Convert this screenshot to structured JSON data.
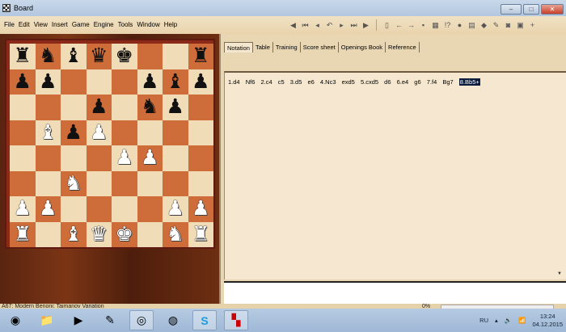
{
  "window": {
    "title": "Board",
    "minimize": "–",
    "maximize": "□",
    "close": "✕"
  },
  "menu": [
    "File",
    "Edit",
    "View",
    "Insert",
    "Game",
    "Engine",
    "Tools",
    "Window",
    "Help"
  ],
  "toolbar_icons": [
    "back-circle-icon",
    "first-move-icon",
    "prev-move-icon",
    "takeback-icon",
    "next-move-icon",
    "last-move-icon",
    "forward-circle-icon",
    "new-document-icon",
    "arrow-left-icon",
    "arrow-right-icon",
    "save-icon",
    "database-icon",
    "analysis-icon",
    "engine-icon",
    "clipboard-icon",
    "eraser-icon",
    "pen-icon",
    "camera-icon",
    "report-icon",
    "crosshair-icon"
  ],
  "tabs": [
    {
      "label": "Notation",
      "active": true
    },
    {
      "label": "Table"
    },
    {
      "label": "Training"
    },
    {
      "label": "Score sheet"
    },
    {
      "label": "Openings Book"
    },
    {
      "label": "Reference"
    }
  ],
  "board": {
    "ranks": [
      [
        "r",
        "n",
        "b",
        "q",
        "k",
        "",
        "",
        "r"
      ],
      [
        "p",
        "p",
        "",
        "",
        "",
        "p",
        "b",
        "p"
      ],
      [
        "",
        "",
        "",
        "p",
        "",
        "n",
        "p",
        ""
      ],
      [
        "",
        "B",
        "p",
        "P",
        "",
        "",
        "",
        ""
      ],
      [
        "",
        "",
        "",
        "",
        "P",
        "P",
        "",
        ""
      ],
      [
        "",
        "",
        "N",
        "",
        "",
        "",
        "",
        ""
      ],
      [
        "P",
        "P",
        "",
        "",
        "",
        "",
        "P",
        "P"
      ],
      [
        "R",
        "",
        "B",
        "Q",
        "K",
        "",
        "N",
        "R"
      ]
    ]
  },
  "notation": {
    "moves": [
      "1.d4",
      "Nf6",
      "2.c4",
      "c5",
      "3.d5",
      "e6",
      "4.Nc3",
      "exd5",
      "5.cxd5",
      "d6",
      "6.e4",
      "g6",
      "7.f4",
      "Bg7",
      "8.Bb5+"
    ],
    "selected_index": 14
  },
  "status": {
    "opening": "A67: Modern Benoni: Taimanov Variation",
    "progress": "0%"
  },
  "taskbar": {
    "apps": [
      "start",
      "explorer",
      "media-player",
      "tools",
      "chrome",
      "firefox",
      "skype",
      "chess-app"
    ],
    "language": "RU",
    "time": "13:24",
    "date": "04.12.2015"
  },
  "colors": {
    "light_square": "#f1dcb8",
    "dark_square": "#cf6d3a",
    "selection": "#0a1a3a"
  }
}
